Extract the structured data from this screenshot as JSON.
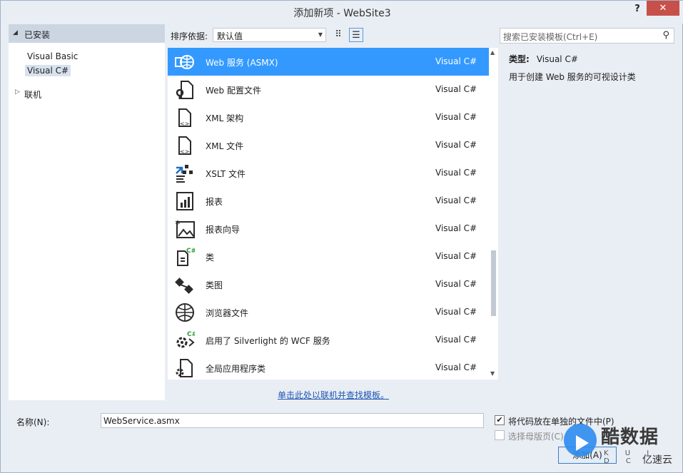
{
  "window": {
    "title": "添加新项 - WebSite3",
    "help": "?",
    "close": "✕"
  },
  "left_panel": {
    "installed": {
      "label": "已安装",
      "arrow": "◢"
    },
    "items": [
      "Visual Basic",
      "Visual C#"
    ],
    "online": {
      "label": "联机",
      "arrow": "▷"
    }
  },
  "toolbar": {
    "sort_label": "排序依据:",
    "sort_value": "默认值",
    "caret": "▼",
    "grid_view_glyph": "⠿",
    "list_view_glyph": "☰"
  },
  "search": {
    "placeholder": "搜索已安装模板(Ctrl+E)",
    "icon": "⚲"
  },
  "templates": [
    {
      "name": "Web 服务 (ASMX)",
      "lang": "Visual C#",
      "icon": "web-service-icon"
    },
    {
      "name": "Web 配置文件",
      "lang": "Visual C#",
      "icon": "web-config-icon"
    },
    {
      "name": "XML 架构",
      "lang": "Visual C#",
      "icon": "xml-schema-icon"
    },
    {
      "name": "XML 文件",
      "lang": "Visual C#",
      "icon": "xml-file-icon"
    },
    {
      "name": "XSLT 文件",
      "lang": "Visual C#",
      "icon": "xslt-file-icon"
    },
    {
      "name": "报表",
      "lang": "Visual C#",
      "icon": "report-icon"
    },
    {
      "name": "报表向导",
      "lang": "Visual C#",
      "icon": "report-wizard-icon"
    },
    {
      "name": "类",
      "lang": "Visual C#",
      "icon": "class-icon"
    },
    {
      "name": "类图",
      "lang": "Visual C#",
      "icon": "class-diagram-icon"
    },
    {
      "name": "浏览器文件",
      "lang": "Visual C#",
      "icon": "browser-file-icon"
    },
    {
      "name": "启用了 Silverlight 的 WCF 服务",
      "lang": "Visual C#",
      "icon": "wcf-service-icon"
    },
    {
      "name": "全局应用程序类",
      "lang": "Visual C#",
      "icon": "global-app-class-icon"
    }
  ],
  "info": {
    "type_label": "类型:",
    "type_value": "Visual C#",
    "description": "用于创建 Web 服务的可视设计类"
  },
  "online_link": "单击此处以联机并查找模板。",
  "bottom": {
    "name_label": "名称(N):",
    "name_value": "WebService.asmx",
    "separate_file_label": "将代码放在单独的文件中(P)",
    "separate_file_check": "✔",
    "master_page_label": "选择母版页(C)",
    "add_button": "添加(A)"
  },
  "watermark": {
    "brand": "酷数据",
    "sub": "K U I D C",
    "yisu": "亿速云"
  },
  "colors": {
    "selection": "#3399ff",
    "close": "#c7514a",
    "link": "#1e55b3"
  }
}
